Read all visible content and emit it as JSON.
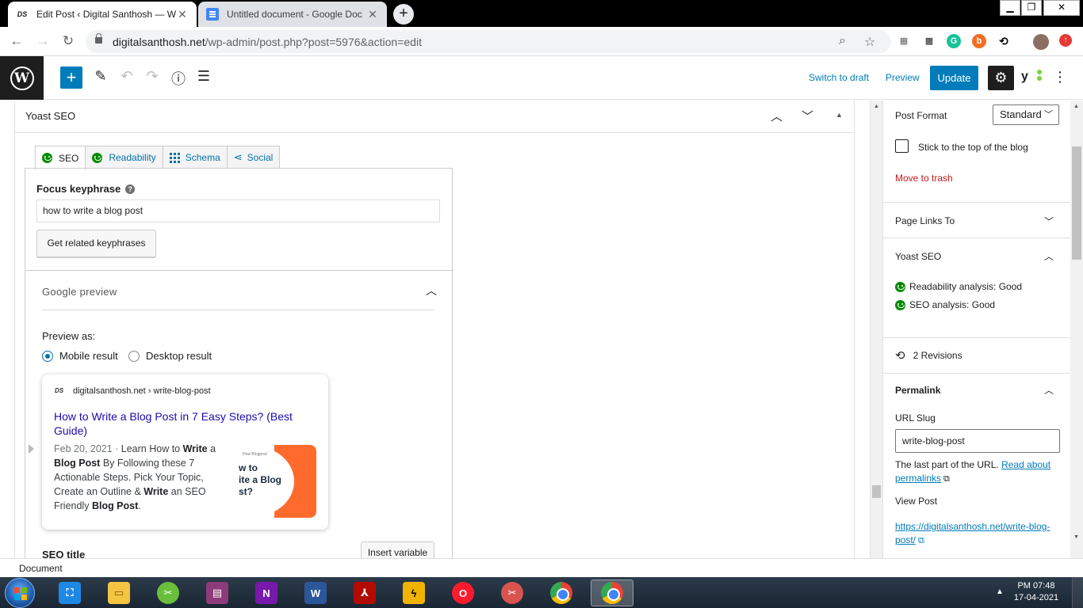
{
  "browser": {
    "tabs": [
      {
        "title": "Edit Post ‹ Digital Santhosh — W",
        "favicon": "DS"
      },
      {
        "title": "Untitled document - Google Doc"
      }
    ],
    "url_host": "digitalsanthosh.net",
    "url_path": "/wp-admin/post.php?post=5976&action=edit"
  },
  "wp_header": {
    "switch_to_draft": "Switch to draft",
    "preview": "Preview",
    "update": "Update",
    "yoast_letter": "y"
  },
  "yoast_panel": {
    "title": "Yoast SEO",
    "tabs": [
      "SEO",
      "Readability",
      "Schema",
      "Social"
    ],
    "focus_keyphrase_label": "Focus keyphrase",
    "focus_keyphrase_value": "how to write a blog post",
    "related_button": "Get related keyphrases",
    "google_preview_title": "Google preview",
    "preview_as": "Preview as:",
    "mobile_result": "Mobile result",
    "desktop_result": "Desktop result",
    "serp": {
      "favicon": "DS",
      "breadcrumb": "digitalsanthosh.net › write-blog-post",
      "title": "How to Write a Blog Post in 7 Easy Steps? (Best Guide)",
      "date": "Feb 20, 2021",
      "date_sep": " · ",
      "desc_1": "Learn How to ",
      "desc_b1": "Write",
      "desc_2": " a ",
      "desc_b2": "Blog Post",
      "desc_3": " By Following these 7 Actionable Steps. Pick Your Topic, Create an Outline & ",
      "desc_b3": "Write",
      "desc_4": " an SEO Friendly ",
      "desc_b4": "Blog Post",
      "desc_5": ".",
      "thumb_small": "How Blogpost",
      "thumb_line1": "w to",
      "thumb_line2": "ite a Blog",
      "thumb_line3": "st?"
    },
    "seo_title_label": "SEO title",
    "insert_variable": "Insert variable"
  },
  "sidebar": {
    "post_format_label": "Post Format",
    "post_format_value": "Standard",
    "stick_to_top": "Stick to the top of the blog",
    "move_to_trash": "Move to trash",
    "page_links_to": "Page Links To",
    "yoast_seo": "Yoast SEO",
    "readability": "Readability analysis: Good",
    "seo_analysis": "SEO analysis: Good",
    "revisions": "2 Revisions",
    "permalink": "Permalink",
    "url_slug_label": "URL Slug",
    "url_slug_value": "write-blog-post",
    "slug_note": "The last part of the URL. ",
    "read_about": "Read about permalinks",
    "view_post": "View Post",
    "view_post_url": "https://digitalsanthosh.net/write-blog-post/"
  },
  "footer": {
    "breadcrumb": "Document"
  },
  "taskbar": {
    "clock_time": "PM 07:48",
    "clock_date": "17-04-2021"
  },
  "colors": {
    "wp_blue": "#007cba",
    "yoast_good": "#008a00",
    "trash_red": "#cc1818",
    "serp_link": "#1a0dab"
  }
}
